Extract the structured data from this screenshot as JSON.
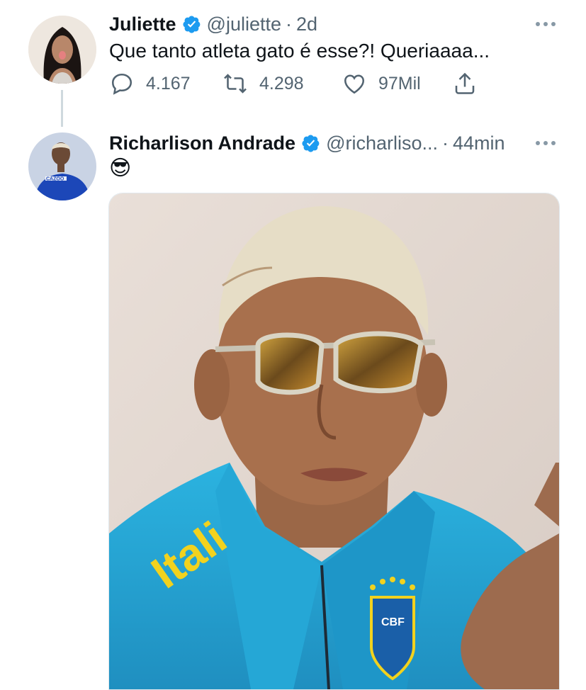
{
  "tweets": [
    {
      "name": "Juliette",
      "handle": "@juliette",
      "dot": "·",
      "time": "2d",
      "text": "Que tanto atleta gato é esse?! Queriaaaa...",
      "replies": "4.167",
      "retweets": "4.298",
      "likes": "97Mil"
    },
    {
      "name": "Richarlison Andrade",
      "handle": "@richarliso...",
      "dot": "·",
      "time": "44min",
      "text": "😎",
      "media_jersey_text": "Itali",
      "media_badge_text": "CBF"
    }
  ],
  "icons": {
    "verified": "verified-badge-icon",
    "more": "more-dots-icon",
    "reply": "reply-icon",
    "retweet": "retweet-icon",
    "like": "heart-icon",
    "share": "share-icon"
  },
  "colors": {
    "verified": "#1d9bf0",
    "secondary_text": "#536471",
    "thread_line": "#cfd9de"
  }
}
